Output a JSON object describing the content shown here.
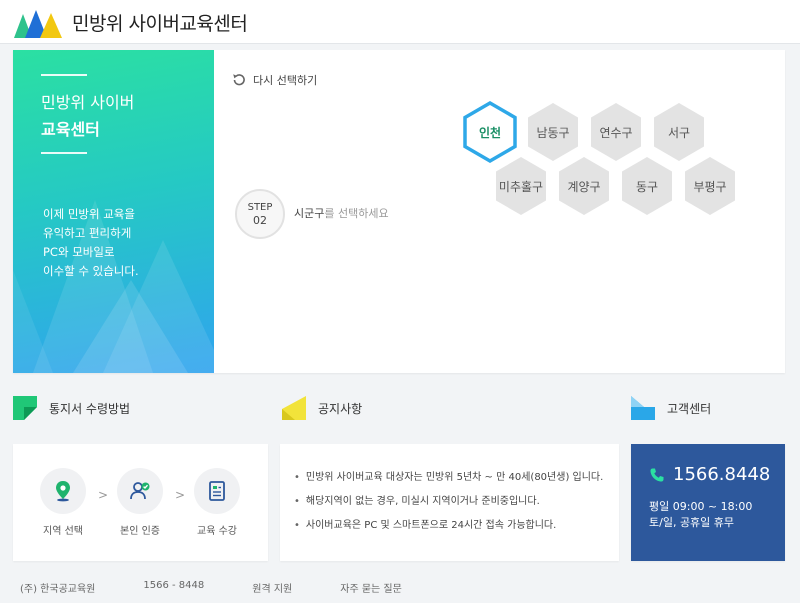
{
  "header": {
    "title": "민방위 사이버교육센터",
    "logo_icon": "mountains-logo"
  },
  "promo": {
    "title_line1": "민방위 사이버",
    "title_line2": "교육센터",
    "desc": [
      "이제 민방위 교육을",
      "유익하고 편리하게",
      "PC와 모바일로",
      "이수할 수 있습니다."
    ]
  },
  "selector": {
    "reset_label": "다시 선택하기",
    "step_label": "STEP",
    "step_number": "02",
    "step_highlight": "시군구",
    "step_text": "를 선택하세요",
    "active_region": "인천",
    "districts": [
      "남동구",
      "연수구",
      "서구",
      "미추홀구",
      "계양구",
      "동구",
      "부평구"
    ]
  },
  "sections": {
    "method_title": "통지서 수령방법",
    "notice_title": "공지사항",
    "cs_title": "고객센터"
  },
  "method_steps": [
    "지역 선택",
    "본인 인증",
    "교육 수강"
  ],
  "notices": [
    "민방위 사이버교육 대상자는 민방위 5년차 ~ 만 40세(80년생) 입니다.",
    "해당지역이 없는 경우, 미실시 지역이거나 준비중입니다.",
    "사이버교육은 PC 및 스마트폰으로 24시간 접속 가능합니다."
  ],
  "customer_center": {
    "phone": "1566.8448",
    "hours_weekday": "평일 09:00 ~ 18:00",
    "hours_weekend": "토/일, 공휴일 휴무"
  },
  "footer": [
    "(주) 한국공교육원",
    "1566 - 8448",
    "원격 지원",
    "자주 묻는 질문"
  ],
  "colors": {
    "accent_green": "#28d6a6",
    "accent_blue": "#30a3ef",
    "active_hex_border": "#2ea8e8",
    "cs_bg": "#2d589c"
  }
}
